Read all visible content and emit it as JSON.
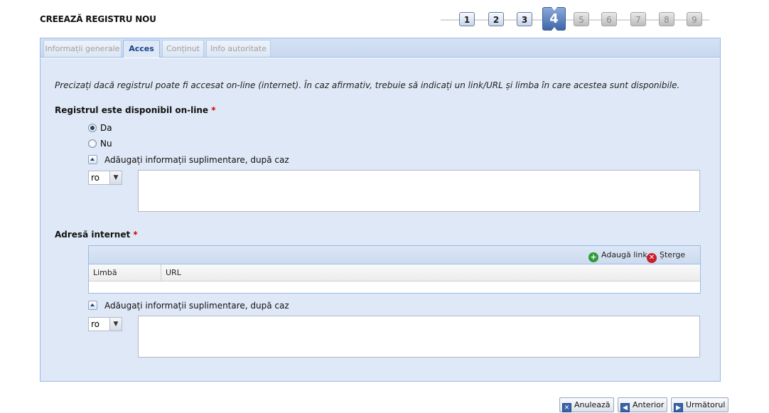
{
  "page": {
    "title": "CREEAZĂ REGISTRU NOU"
  },
  "stepper": {
    "steps": [
      "1",
      "2",
      "3",
      "4",
      "5",
      "6",
      "7",
      "8",
      "9"
    ],
    "current": 4
  },
  "tabs": [
    {
      "label": "Informații generale",
      "active": false
    },
    {
      "label": "Acces",
      "active": true
    },
    {
      "label": "Conținut",
      "active": false
    },
    {
      "label": "Info autoritate",
      "active": false
    }
  ],
  "intro": "Precizați dacă registrul poate fi accesat on-line (internet). În caz afirmativ, trebuie să indicați un link/URL și limba în care acestea sunt disponibile.",
  "online": {
    "label": "Registrul este disponibil on-line",
    "required_mark": "*",
    "options": [
      {
        "label": "Da",
        "checked": true
      },
      {
        "label": "Nu",
        "checked": false
      }
    ],
    "more_info": "Adăugați informații suplimentare, după caz",
    "lang": "ro",
    "text": ""
  },
  "address": {
    "label": "Adresă internet",
    "required_mark": "*",
    "toolbar": {
      "add": "Adaugă link",
      "delete": "Șterge link"
    },
    "columns": [
      "Limbă",
      "URL"
    ],
    "rows": [],
    "more_info": "Adăugați informații suplimentare, după caz",
    "lang": "ro",
    "text": ""
  },
  "buttons": {
    "cancel": "Anulează",
    "prev": "Anterior",
    "next": "Următorul"
  },
  "colors": {
    "panel_bg": "#dfe8f6",
    "panel_border": "#99bbe8",
    "active_tab": "#15428b",
    "required": "#d40000",
    "step_active": "#3e67a9"
  },
  "icons": {
    "add": "plus-circle-icon",
    "delete": "x-circle-icon",
    "cancel": "x-square-icon",
    "prev": "arrow-left-icon",
    "next": "arrow-right-icon"
  }
}
